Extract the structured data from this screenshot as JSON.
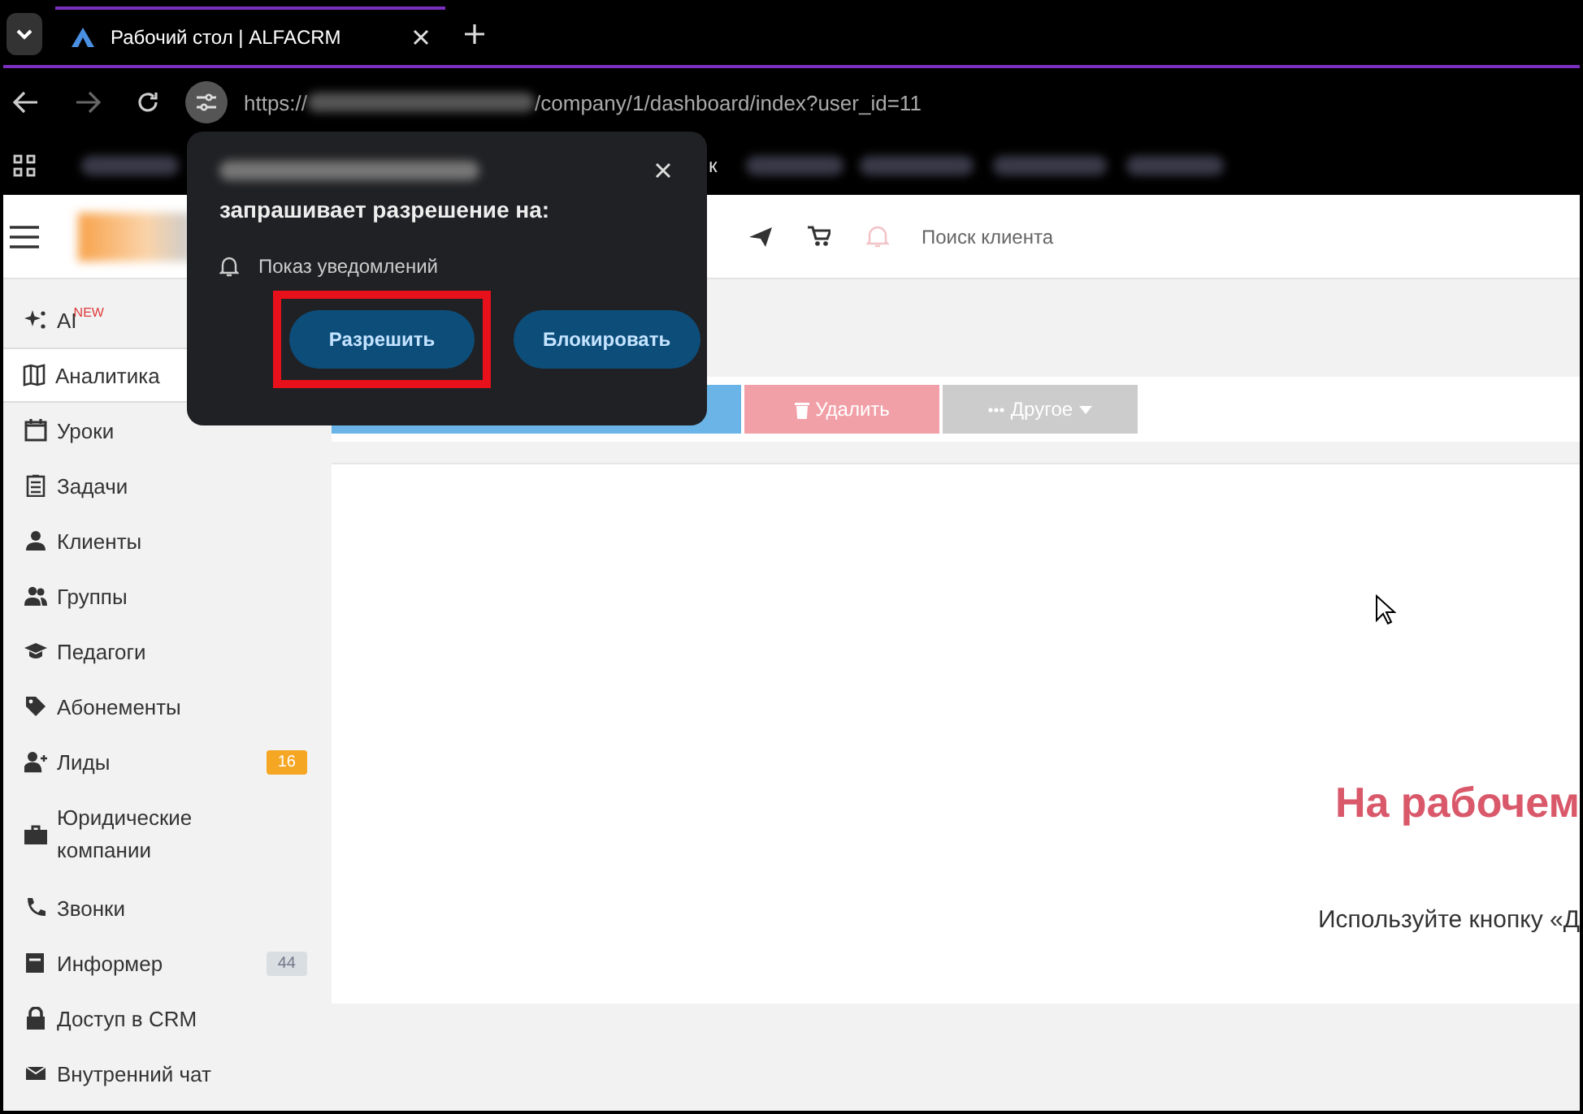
{
  "browser": {
    "tab": {
      "title": "Рабочий стол | ALFACRM"
    },
    "address_start": "https://",
    "address_end": "/company/1/dashboard/index?user_id=11",
    "bookmark_fragment": "к"
  },
  "header": {
    "search": {
      "placeholder": "Поиск клиента"
    }
  },
  "sidebar": {
    "items": [
      {
        "label": "AI",
        "tag": "NEW",
        "selected": false
      },
      {
        "label": "Аналитика",
        "selected": true
      },
      {
        "label": "Уроки",
        "selected": false
      },
      {
        "label": "Задачи",
        "selected": false
      },
      {
        "label": "Клиенты",
        "selected": false
      },
      {
        "label": "Группы",
        "selected": false
      },
      {
        "label": "Педагоги",
        "selected": false
      },
      {
        "label": "Абонементы",
        "selected": false
      },
      {
        "label": "Лиды",
        "badge": "16",
        "color": "#f5a623",
        "selected": false
      },
      {
        "label": "Юридические компании",
        "selected": false
      },
      {
        "label": "Звонки",
        "selected": false
      },
      {
        "label": "Информер",
        "badge": "44",
        "color": "#d9dee2",
        "selected": false
      },
      {
        "label": "Доступ в CRM",
        "selected": false
      },
      {
        "label": "Внутренний чат",
        "selected": false
      }
    ]
  },
  "toolbar": {
    "buttons": [
      {
        "kind": "primary"
      },
      {
        "kind": "danger",
        "label": "Удалить"
      },
      {
        "kind": "dropdown",
        "label": "Другое"
      }
    ]
  },
  "content": {
    "heading": "На рабочем",
    "hint": "Используйте кнопку «Д"
  },
  "permission_popup": {
    "message": "запрашивает разрешение на:",
    "permission": "Показ уведомлений",
    "buttons": [
      {
        "label": "Разрешить",
        "highlighted": true
      },
      {
        "label": "Блокировать",
        "highlighted": false
      }
    ]
  }
}
